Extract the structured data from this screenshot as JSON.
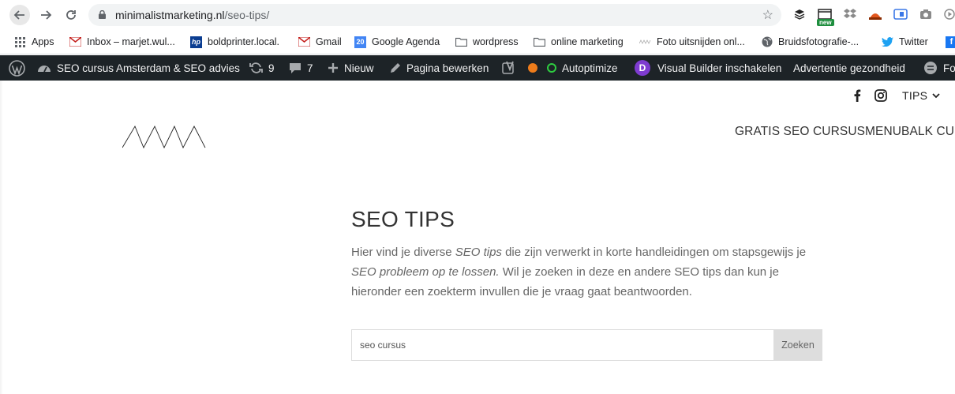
{
  "browser": {
    "url_host": "minimalistmarketing.nl",
    "url_path": "/seo-tips/",
    "ext_badge": "new"
  },
  "bookmarks": [
    {
      "label": "Apps",
      "icon": "apps-grid-icon"
    },
    {
      "label": "Inbox – marjet.wul...",
      "icon": "gmail-icon"
    },
    {
      "label": "boldprinter.local.",
      "icon": "hp-icon"
    },
    {
      "label": "Gmail",
      "icon": "gmail-icon"
    },
    {
      "label": "Google Agenda",
      "icon": "calendar-icon",
      "badge": "20"
    },
    {
      "label": "wordpress",
      "icon": "folder-icon"
    },
    {
      "label": "online marketing",
      "icon": "folder-icon"
    },
    {
      "label": "Foto uitsnijden onl...",
      "icon": "wave-icon"
    },
    {
      "label": "Bruidsfotografie-...",
      "icon": "globe-icon"
    },
    {
      "label": "Twitter",
      "icon": "twitter-icon"
    }
  ],
  "wpbar": {
    "site_name": "SEO cursus Amsterdam & SEO advies",
    "updates_count": "9",
    "comments_count": "7",
    "new_label": "Nieuw",
    "edit_label": "Pagina bewerken",
    "autoptimize_label": "Autoptimize",
    "visual_builder_label": "Visual Builder inschakelen",
    "ad_health_label": "Advertentie gezondheid",
    "truncated_label": "Fo"
  },
  "header": {
    "tips_label": "TIPS",
    "nav": [
      "GRATIS SEO CURSUS",
      "MENUBALK CURS"
    ]
  },
  "main": {
    "title": "SEO TIPS",
    "intro_1": "Hier vind je diverse ",
    "intro_em_1": "SEO tips",
    "intro_2": " die zijn verwerkt in korte handleidingen om stapsgewijs je ",
    "intro_em_2": "SEO probleem op te lossen.",
    "intro_3": " Wil je zoeken in deze en andere SEO tips dan kun je hieronder een zoekterm invullen die je vraag gaat beantwoorden.",
    "search_value": "seo cursus",
    "search_button": "Zoeken"
  },
  "colors": {
    "wpbar_bg": "#1d2327",
    "autoptimize_ring": "#2ecc40",
    "yoast_dot": "#ee7c1b",
    "divi_purple": "#7e3bd0",
    "search_button_bg": "#dddddd"
  }
}
